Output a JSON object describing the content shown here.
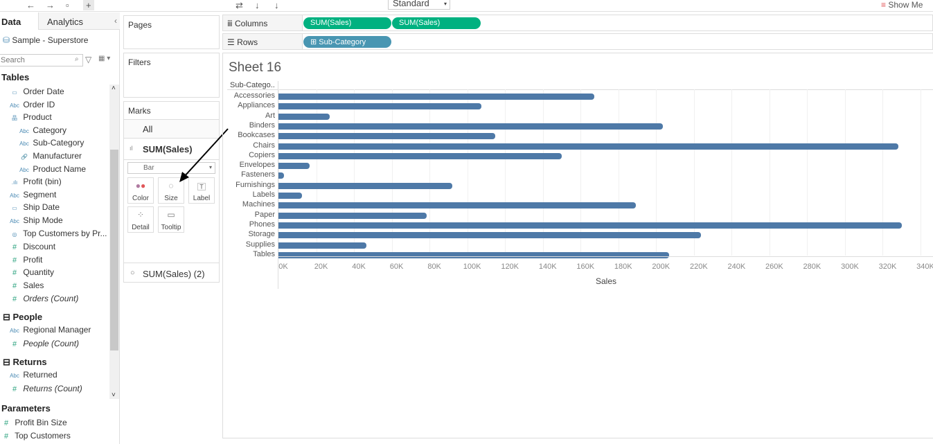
{
  "toolbar": {
    "standard": "Standard",
    "show_me": "Show Me"
  },
  "left": {
    "tab_data": "Data",
    "tab_analytics": "Analytics",
    "datasource": "Sample - Superstore",
    "search_placeholder": "Search",
    "tables_header": "Tables",
    "fields": [
      {
        "icon": "date",
        "label": "Order Date",
        "indent": 1
      },
      {
        "icon": "abc",
        "label": "Order ID",
        "indent": 1
      },
      {
        "icon": "hierarchy",
        "label": "Product",
        "indent": 1
      },
      {
        "icon": "abc",
        "label": "Category",
        "indent": 2
      },
      {
        "icon": "abc",
        "label": "Sub-Category",
        "indent": 2
      },
      {
        "icon": "link",
        "label": "Manufacturer",
        "indent": 2
      },
      {
        "icon": "abc",
        "label": "Product Name",
        "indent": 2
      },
      {
        "icon": "bin",
        "label": "Profit (bin)",
        "indent": 1
      },
      {
        "icon": "abc",
        "label": "Segment",
        "indent": 1
      },
      {
        "icon": "date",
        "label": "Ship Date",
        "indent": 1
      },
      {
        "icon": "abc",
        "label": "Ship Mode",
        "indent": 1
      },
      {
        "icon": "set",
        "label": "Top Customers by Pr...",
        "indent": 1
      },
      {
        "icon": "#",
        "label": "Discount",
        "indent": 1
      },
      {
        "icon": "#",
        "label": "Profit",
        "indent": 1
      },
      {
        "icon": "#",
        "label": "Quantity",
        "indent": 1
      },
      {
        "icon": "#",
        "label": "Sales",
        "indent": 1
      },
      {
        "icon": "#",
        "label": "Orders (Count)",
        "indent": 1,
        "italic": true
      }
    ],
    "people_header": "People",
    "people": [
      {
        "icon": "abc",
        "label": "Regional Manager"
      },
      {
        "icon": "#",
        "label": "People (Count)",
        "italic": true
      }
    ],
    "returns_header": "Returns",
    "returns": [
      {
        "icon": "abc",
        "label": "Returned"
      },
      {
        "icon": "#",
        "label": "Returns (Count)",
        "italic": true
      }
    ],
    "parameters_header": "Parameters",
    "parameters": [
      {
        "icon": "#",
        "label": "Profit Bin Size"
      },
      {
        "icon": "#",
        "label": "Top Customers"
      }
    ]
  },
  "cards": {
    "pages": "Pages",
    "filters": "Filters",
    "marks": "Marks",
    "all": "All",
    "measure": "SUM(Sales)",
    "mark_type": "Bar",
    "buttons": {
      "color": "Color",
      "size": "Size",
      "label": "Label",
      "detail": "Detail",
      "tooltip": "Tooltip"
    },
    "measure2": "SUM(Sales) (2)"
  },
  "shelves": {
    "columns": "Columns",
    "rows": "Rows",
    "col_pills": [
      "SUM(Sales)",
      "SUM(Sales)"
    ],
    "row_pill": "Sub-Category"
  },
  "sheet_title": "Sheet 16",
  "chart_data": {
    "type": "bar",
    "orientation": "horizontal",
    "row_header": "Sub-Catego..",
    "categories": [
      "Accessories",
      "Appliances",
      "Art",
      "Binders",
      "Bookcases",
      "Chairs",
      "Copiers",
      "Envelopes",
      "Fasteners",
      "Furnishings",
      "Labels",
      "Machines",
      "Paper",
      "Phones",
      "Storage",
      "Supplies",
      "Tables"
    ],
    "values": [
      167.4,
      107.5,
      27.1,
      203.4,
      114.9,
      328.4,
      150.0,
      16.5,
      3.0,
      92.0,
      12.5,
      189.2,
      78.5,
      330.0,
      223.8,
      46.7,
      206.9
    ],
    "value_units": "thousands",
    "xlabel": "Sales",
    "xlim": [
      0,
      340
    ],
    "ticks": [
      "0K",
      "20K",
      "40K",
      "60K",
      "80K",
      "100K",
      "120K",
      "140K",
      "160K",
      "180K",
      "200K",
      "220K",
      "240K",
      "260K",
      "280K",
      "300K",
      "320K",
      "340K"
    ],
    "color": "#4e79a7"
  }
}
